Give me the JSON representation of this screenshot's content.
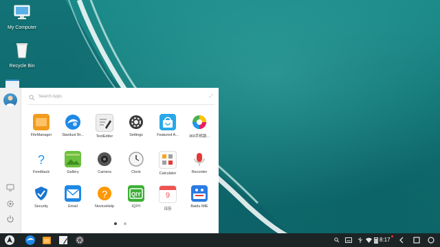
{
  "desktop": {
    "icons": [
      {
        "label": "My Computer",
        "icon": "monitor-icon"
      },
      {
        "label": "Recycle Bin",
        "icon": "trash-icon"
      }
    ]
  },
  "start_menu": {
    "search_placeholder": "Search Apps",
    "side_buttons": [
      "screen-icon",
      "settings-gear-icon",
      "power-icon"
    ],
    "apps": [
      {
        "label": "FileManager",
        "icon": "folder-icon",
        "color": "#f29b1d"
      },
      {
        "label": "Stardust Br...",
        "icon": "globe-browser-icon",
        "color": "#1e88e5"
      },
      {
        "label": "TextEditor",
        "icon": "text-editor-icon",
        "color": "#eeeeee"
      },
      {
        "label": "Settings",
        "icon": "settings-gear-icon",
        "color": "#3a3a3a"
      },
      {
        "label": "Featured A...",
        "icon": "shopping-bag-icon",
        "color": "#29a8e8"
      },
      {
        "label": "360手机助...",
        "icon": "color-wheel-icon",
        "color": "#4caf50"
      },
      {
        "label": "Feedback",
        "icon": "question-icon",
        "color": "#2196f3"
      },
      {
        "label": "Gallery",
        "icon": "gallery-icon",
        "color": "#6cbf3f"
      },
      {
        "label": "Camera",
        "icon": "camera-icon",
        "color": "#555555"
      },
      {
        "label": "Clock",
        "icon": "clock-icon",
        "color": "#e0e0e0"
      },
      {
        "label": "Calculator",
        "icon": "calculator-icon",
        "color": "#f5a623"
      },
      {
        "label": "Recorder",
        "icon": "recorder-icon",
        "color": "#e53935"
      },
      {
        "label": "Security",
        "icon": "shield-icon",
        "color": "#1976d2"
      },
      {
        "label": "Email",
        "icon": "email-icon",
        "color": "#1e88e5"
      },
      {
        "label": "NoviceHelp",
        "icon": "help-icon",
        "color": "#ff9800"
      },
      {
        "label": "IQIYI",
        "icon": "iqiyi-icon",
        "color": "#3cb035"
      },
      {
        "label": "日历",
        "icon": "calendar-icon",
        "color": "#ef5350"
      },
      {
        "label": "Baidu IME",
        "icon": "baidu-ime-icon",
        "color": "#2a7be4"
      }
    ],
    "calendar_day": "9",
    "page_dots": 2,
    "active_page": 1
  },
  "taskbar": {
    "pinned": [
      "start-icon",
      "browser-icon",
      "folder-icon",
      "text-editor-icon",
      "settings-gear-icon"
    ],
    "clock": "8:17",
    "tray_icons": [
      "search-icon",
      "keyboard-icon",
      "usb-icon",
      "wifi-icon",
      "battery-icon",
      "notification-icon"
    ],
    "nav_icons": [
      "back-icon",
      "recents-icon",
      "home-icon"
    ]
  }
}
